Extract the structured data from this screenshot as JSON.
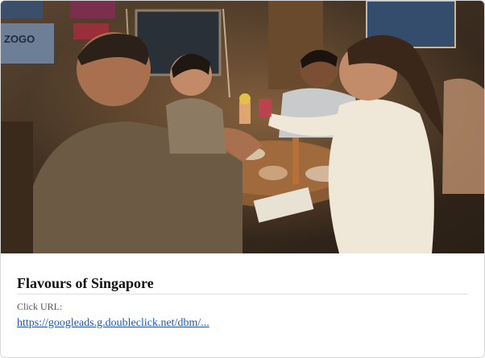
{
  "ad": {
    "title": "Flavours of Singapore",
    "click_url_label": "Click URL:",
    "click_url": "https://googleads.g.doubleclick.net/dbm/..."
  },
  "photo": {
    "poster_text": "ZOGO",
    "subject": "friends-toasting-drinks-at-restaurant-table"
  },
  "colors": {
    "link": "#1a56c4",
    "title": "#111111",
    "label": "#555555"
  }
}
